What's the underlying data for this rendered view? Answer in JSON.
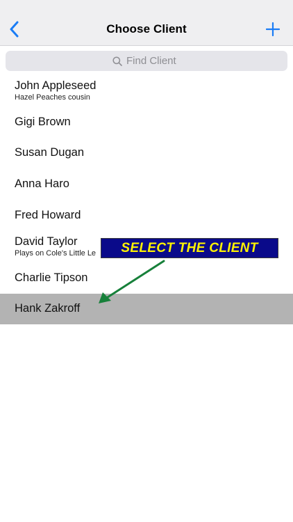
{
  "nav": {
    "title": "Choose Client",
    "back_icon": "chevron-left-icon",
    "add_icon": "plus-icon",
    "accent_color": "#1a7cf5"
  },
  "search": {
    "placeholder": "Find Client",
    "value": "",
    "icon": "search-icon"
  },
  "clients": [
    {
      "name": "John Appleseed",
      "note": "Hazel Peaches cousin"
    },
    {
      "name": "Gigi Brown",
      "note": ""
    },
    {
      "name": "Susan Dugan",
      "note": ""
    },
    {
      "name": "Anna Haro",
      "note": ""
    },
    {
      "name": "Fred Howard",
      "note": ""
    },
    {
      "name": "David Taylor",
      "note": "Plays on Cole's Little Le"
    },
    {
      "name": "Charlie Tipson",
      "note": ""
    },
    {
      "name": "Hank Zakroff",
      "note": "",
      "selected": true
    }
  ],
  "annotation": {
    "text": "SELECT THE CLIENT",
    "box_color": "#0a0a8a",
    "text_color": "#fff200",
    "arrow_color": "#17803a"
  }
}
